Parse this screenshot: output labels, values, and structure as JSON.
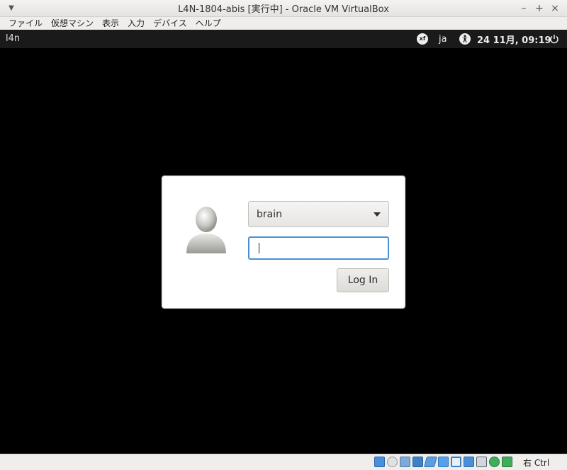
{
  "window": {
    "title": "L4N-1804-abis [実行中] - Oracle VM VirtualBox",
    "controls": [
      "–",
      "+",
      "×"
    ]
  },
  "menu": {
    "items": [
      "ファイル",
      "仮想マシン",
      "表示",
      "入力",
      "デバイス",
      "ヘルプ"
    ]
  },
  "guest": {
    "hostname": "l4n",
    "topbar": {
      "input_method": "ja",
      "clock": "24 11月, 09:19"
    },
    "login": {
      "selected_user": "brain",
      "password_value": "",
      "login_button": "Log In"
    }
  },
  "statusbar": {
    "host_key": "右 Ctrl",
    "icons": [
      "hard-disk-icon",
      "optical-drive-icon",
      "audio-icon",
      "network-icon",
      "usb-icon",
      "shared-folders-icon",
      "display-icon",
      "video-capture-icon",
      "virtualization-icon",
      "mouse-integration-icon",
      "host-key-icon"
    ]
  },
  "colors": {
    "focus_ring": "#4a90d9",
    "vm_background": "#000000",
    "guest_topbar": "#1a1a1a"
  }
}
